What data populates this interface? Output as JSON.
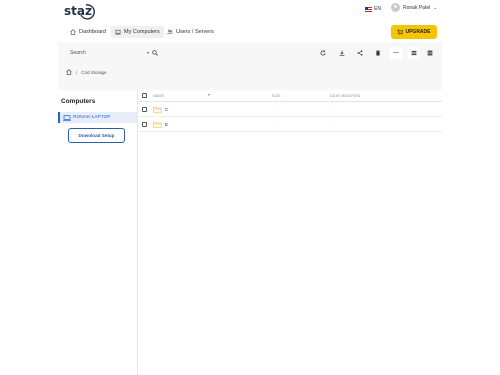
{
  "app": {
    "logo_text": "staz",
    "language": "EN",
    "user_name": "Ronak Patel",
    "upgrade_label": "UPGRADE"
  },
  "nav": {
    "items": [
      {
        "label": "Dashboard",
        "icon": "home-icon",
        "active": false
      },
      {
        "label": "My Computers",
        "icon": "laptop-icon",
        "active": true
      },
      {
        "label": "Users / Servers",
        "icon": "users-icon",
        "active": false
      }
    ]
  },
  "toolbar": {
    "search_placeholder": "Search",
    "icons": [
      "refresh-icon",
      "download-icon",
      "share-icon",
      "delete-icon",
      "more-icon",
      "list-view-icon",
      "grid-view-icon"
    ]
  },
  "breadcrumb": {
    "home_icon": "home-icon",
    "separator": "/",
    "current": "Crid Storage"
  },
  "sidebar": {
    "title": "Computers",
    "items": [
      {
        "label": "RONAK-LAPTOP",
        "icon": "computer-icon",
        "selected": true
      }
    ],
    "download_label": "Download Setup"
  },
  "table": {
    "columns": {
      "name": "NAME",
      "size": "SIZE",
      "date": "DATE MODIFIED"
    },
    "rows": [
      {
        "name": "C",
        "size": "-",
        "date": "-"
      },
      {
        "name": "E",
        "size": "-",
        "date": "-"
      }
    ]
  },
  "colors": {
    "accent": "#1e63d6",
    "upgrade": "#f6c500",
    "folder": "#f6c34a"
  }
}
